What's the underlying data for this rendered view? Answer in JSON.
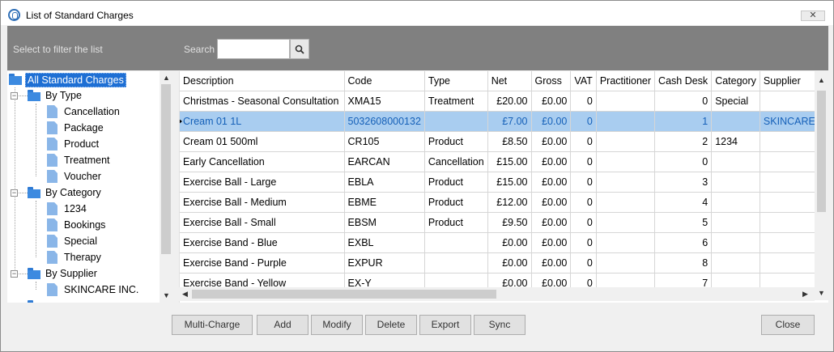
{
  "window": {
    "title": "List of Standard Charges",
    "close_glyph": "✕"
  },
  "filter": {
    "label": "Select to filter the list",
    "search_label": "Search",
    "search_value": "",
    "search_icon": "search-icon"
  },
  "tree": {
    "root": "All Standard Charges",
    "by_type": {
      "label": "By Type",
      "items": [
        "Cancellation",
        "Package",
        "Product",
        "Treatment",
        "Voucher"
      ]
    },
    "by_category": {
      "label": "By Category",
      "items": [
        "1234",
        "Bookings",
        "Special",
        "Therapy"
      ]
    },
    "by_supplier": {
      "label": "By Supplier",
      "items": [
        "SKINCARE INC."
      ]
    }
  },
  "grid": {
    "columns": [
      "Description",
      "Code",
      "Type",
      "Net",
      "Gross",
      "VAT",
      "Practitioner",
      "Cash Desk",
      "Category",
      "Supplier"
    ],
    "rows": [
      [
        "Christmas - Seasonal Consultation",
        "XMA15",
        "Treatment",
        "£20.00",
        "£0.00",
        "0",
        "",
        "0",
        "Special",
        ""
      ],
      [
        "Cream 01 1L",
        "5032608000132",
        "",
        "£7.00",
        "£0.00",
        "0",
        "",
        "1",
        "",
        "SKINCARE I"
      ],
      [
        "Cream 01 500ml",
        "CR105",
        "Product",
        "£8.50",
        "£0.00",
        "0",
        "",
        "2",
        "1234",
        ""
      ],
      [
        "Early Cancellation",
        "EARCAN",
        "Cancellation",
        "£15.00",
        "£0.00",
        "0",
        "",
        "0",
        "",
        ""
      ],
      [
        "Exercise Ball - Large",
        "EBLA",
        "Product",
        "£15.00",
        "£0.00",
        "0",
        "",
        "3",
        "",
        ""
      ],
      [
        "Exercise Ball - Medium",
        "EBME",
        "Product",
        "£12.00",
        "£0.00",
        "0",
        "",
        "4",
        "",
        ""
      ],
      [
        "Exercise Ball - Small",
        "EBSM",
        "Product",
        "£9.50",
        "£0.00",
        "0",
        "",
        "5",
        "",
        ""
      ],
      [
        "Exercise Band - Blue",
        "EXBL",
        "",
        "£0.00",
        "£0.00",
        "0",
        "",
        "6",
        "",
        ""
      ],
      [
        "Exercise Band - Purple",
        "EXPUR",
        "",
        "£0.00",
        "£0.00",
        "0",
        "",
        "8",
        "",
        ""
      ],
      [
        "Exercise Band - Yellow",
        "EX-Y",
        "",
        "£0.00",
        "£0.00",
        "0",
        "",
        "7",
        "",
        ""
      ]
    ],
    "selected_row": 1
  },
  "buttons": {
    "multi_charge": "Multi-Charge",
    "add": "Add",
    "modify": "Modify",
    "delete": "Delete",
    "export": "Export",
    "sync": "Sync",
    "close": "Close"
  },
  "colors": {
    "selection": "#a9cdf0",
    "tree_selection": "#1e6fd4",
    "filter_bar": "#808080"
  }
}
